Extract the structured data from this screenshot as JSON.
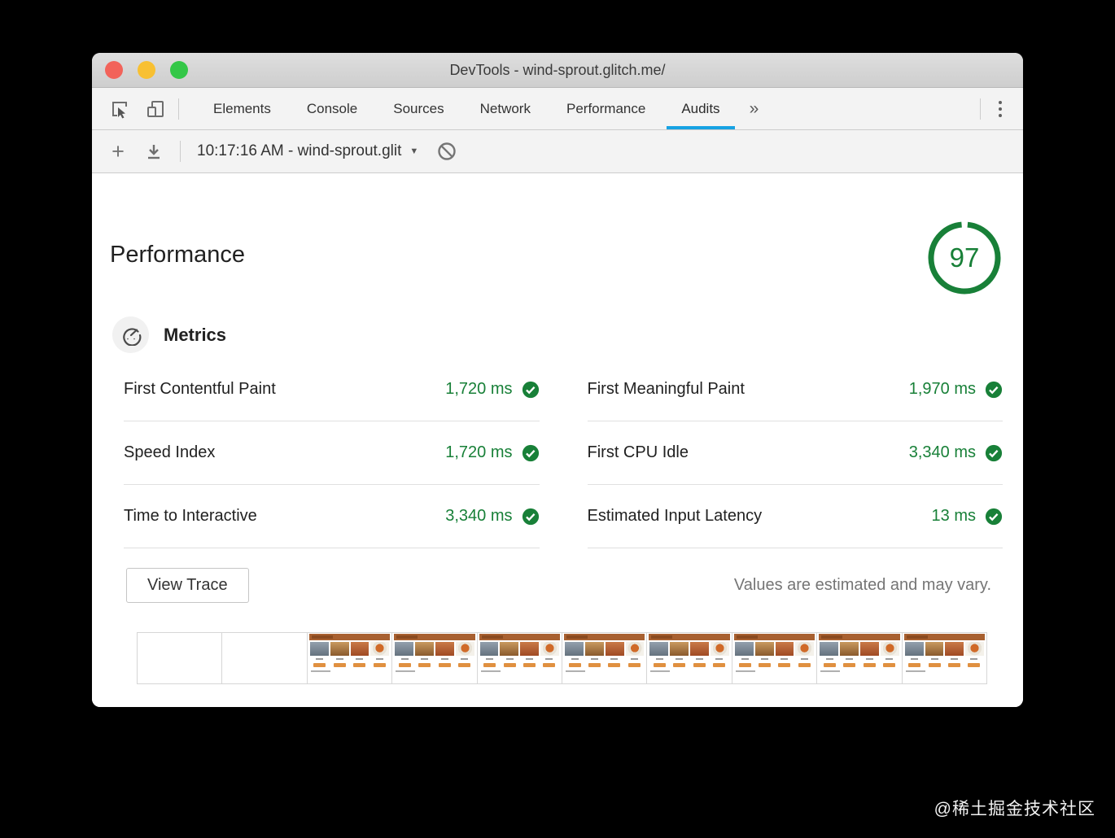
{
  "window": {
    "title": "DevTools - wind-sprout.glitch.me/"
  },
  "traffic_lights": {
    "close_color": "#f2635a",
    "minimize_color": "#f8c032",
    "zoom_color": "#34c748"
  },
  "tabs": {
    "items": [
      {
        "label": "Elements",
        "active": false
      },
      {
        "label": "Console",
        "active": false
      },
      {
        "label": "Sources",
        "active": false
      },
      {
        "label": "Network",
        "active": false
      },
      {
        "label": "Performance",
        "active": false
      },
      {
        "label": "Audits",
        "active": true
      }
    ],
    "overflow_chevron": "»",
    "active_underline_color": "#17a2e3"
  },
  "toolbar": {
    "plus": "+",
    "session_label": "10:17:16 AM - wind-sprout.glit",
    "dropdown_arrow": "▼"
  },
  "report": {
    "title": "Performance",
    "score": "97",
    "score_color": "#188038",
    "metrics_title": "Metrics",
    "metrics": [
      {
        "name": "First Contentful Paint",
        "value": "1,720 ms"
      },
      {
        "name": "First Meaningful Paint",
        "value": "1,970 ms"
      },
      {
        "name": "Speed Index",
        "value": "1,720 ms"
      },
      {
        "name": "First CPU Idle",
        "value": "3,340 ms"
      },
      {
        "name": "Time to Interactive",
        "value": "3,340 ms"
      },
      {
        "name": "Estimated Input Latency",
        "value": "13 ms"
      }
    ],
    "view_trace_label": "View Trace",
    "disclaimer": "Values are estimated and may vary.",
    "filmstrip_frame_count": 10,
    "filmstrip_blank_frames": 2
  },
  "watermark": "@稀土掘金技术社区"
}
